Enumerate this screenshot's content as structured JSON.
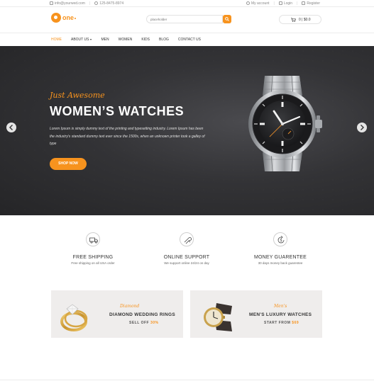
{
  "topbar": {
    "email": "info@yourwed.com",
    "phone": "125-8475-8974",
    "my_account": "My account",
    "login": "Login",
    "register": "Register"
  },
  "header": {
    "logo_text": "one",
    "search_placeholder": "placeholder",
    "cart_text": "0 | $0.0"
  },
  "nav": {
    "items": [
      {
        "label": "HOME"
      },
      {
        "label": "ABOUT US"
      },
      {
        "label": "MEN"
      },
      {
        "label": "WOMEN"
      },
      {
        "label": "KIDS"
      },
      {
        "label": "BLOG"
      },
      {
        "label": "CONTACT US"
      }
    ]
  },
  "hero": {
    "subtitle": "Just Awesome",
    "title": "WOMEN’S WATCHES",
    "text": "Lorem Ipsum is simply dummy text of the printing and typesetting industry. Lorem Ipsum has been the industry's standard dummy text ever since the 1500s, when an unknown printer took a galley of type",
    "button": "SHOP NOW"
  },
  "features": [
    {
      "title": "FREE SHIPPING",
      "desc": "Free shipping on all USA order"
    },
    {
      "title": "ONLINE SUPPORT",
      "desc": "We support online 24/24 on day"
    },
    {
      "title": "MONEY GUARENTEE",
      "desc": "30 days money back guarentee"
    }
  ],
  "banners": [
    {
      "subtitle": "Diamond",
      "title": "DIAMOND WEDDING RINGS",
      "price_prefix": "SELL OFF",
      "price_value": "30%"
    },
    {
      "subtitle": "Men's",
      "title": "MEN'S LUXURY WATCHES",
      "price_prefix": "START FROM",
      "price_value": "$69"
    }
  ],
  "colors": {
    "accent": "#f7931e",
    "hero_bg": "#333336",
    "banner_bg": "#efedec"
  }
}
